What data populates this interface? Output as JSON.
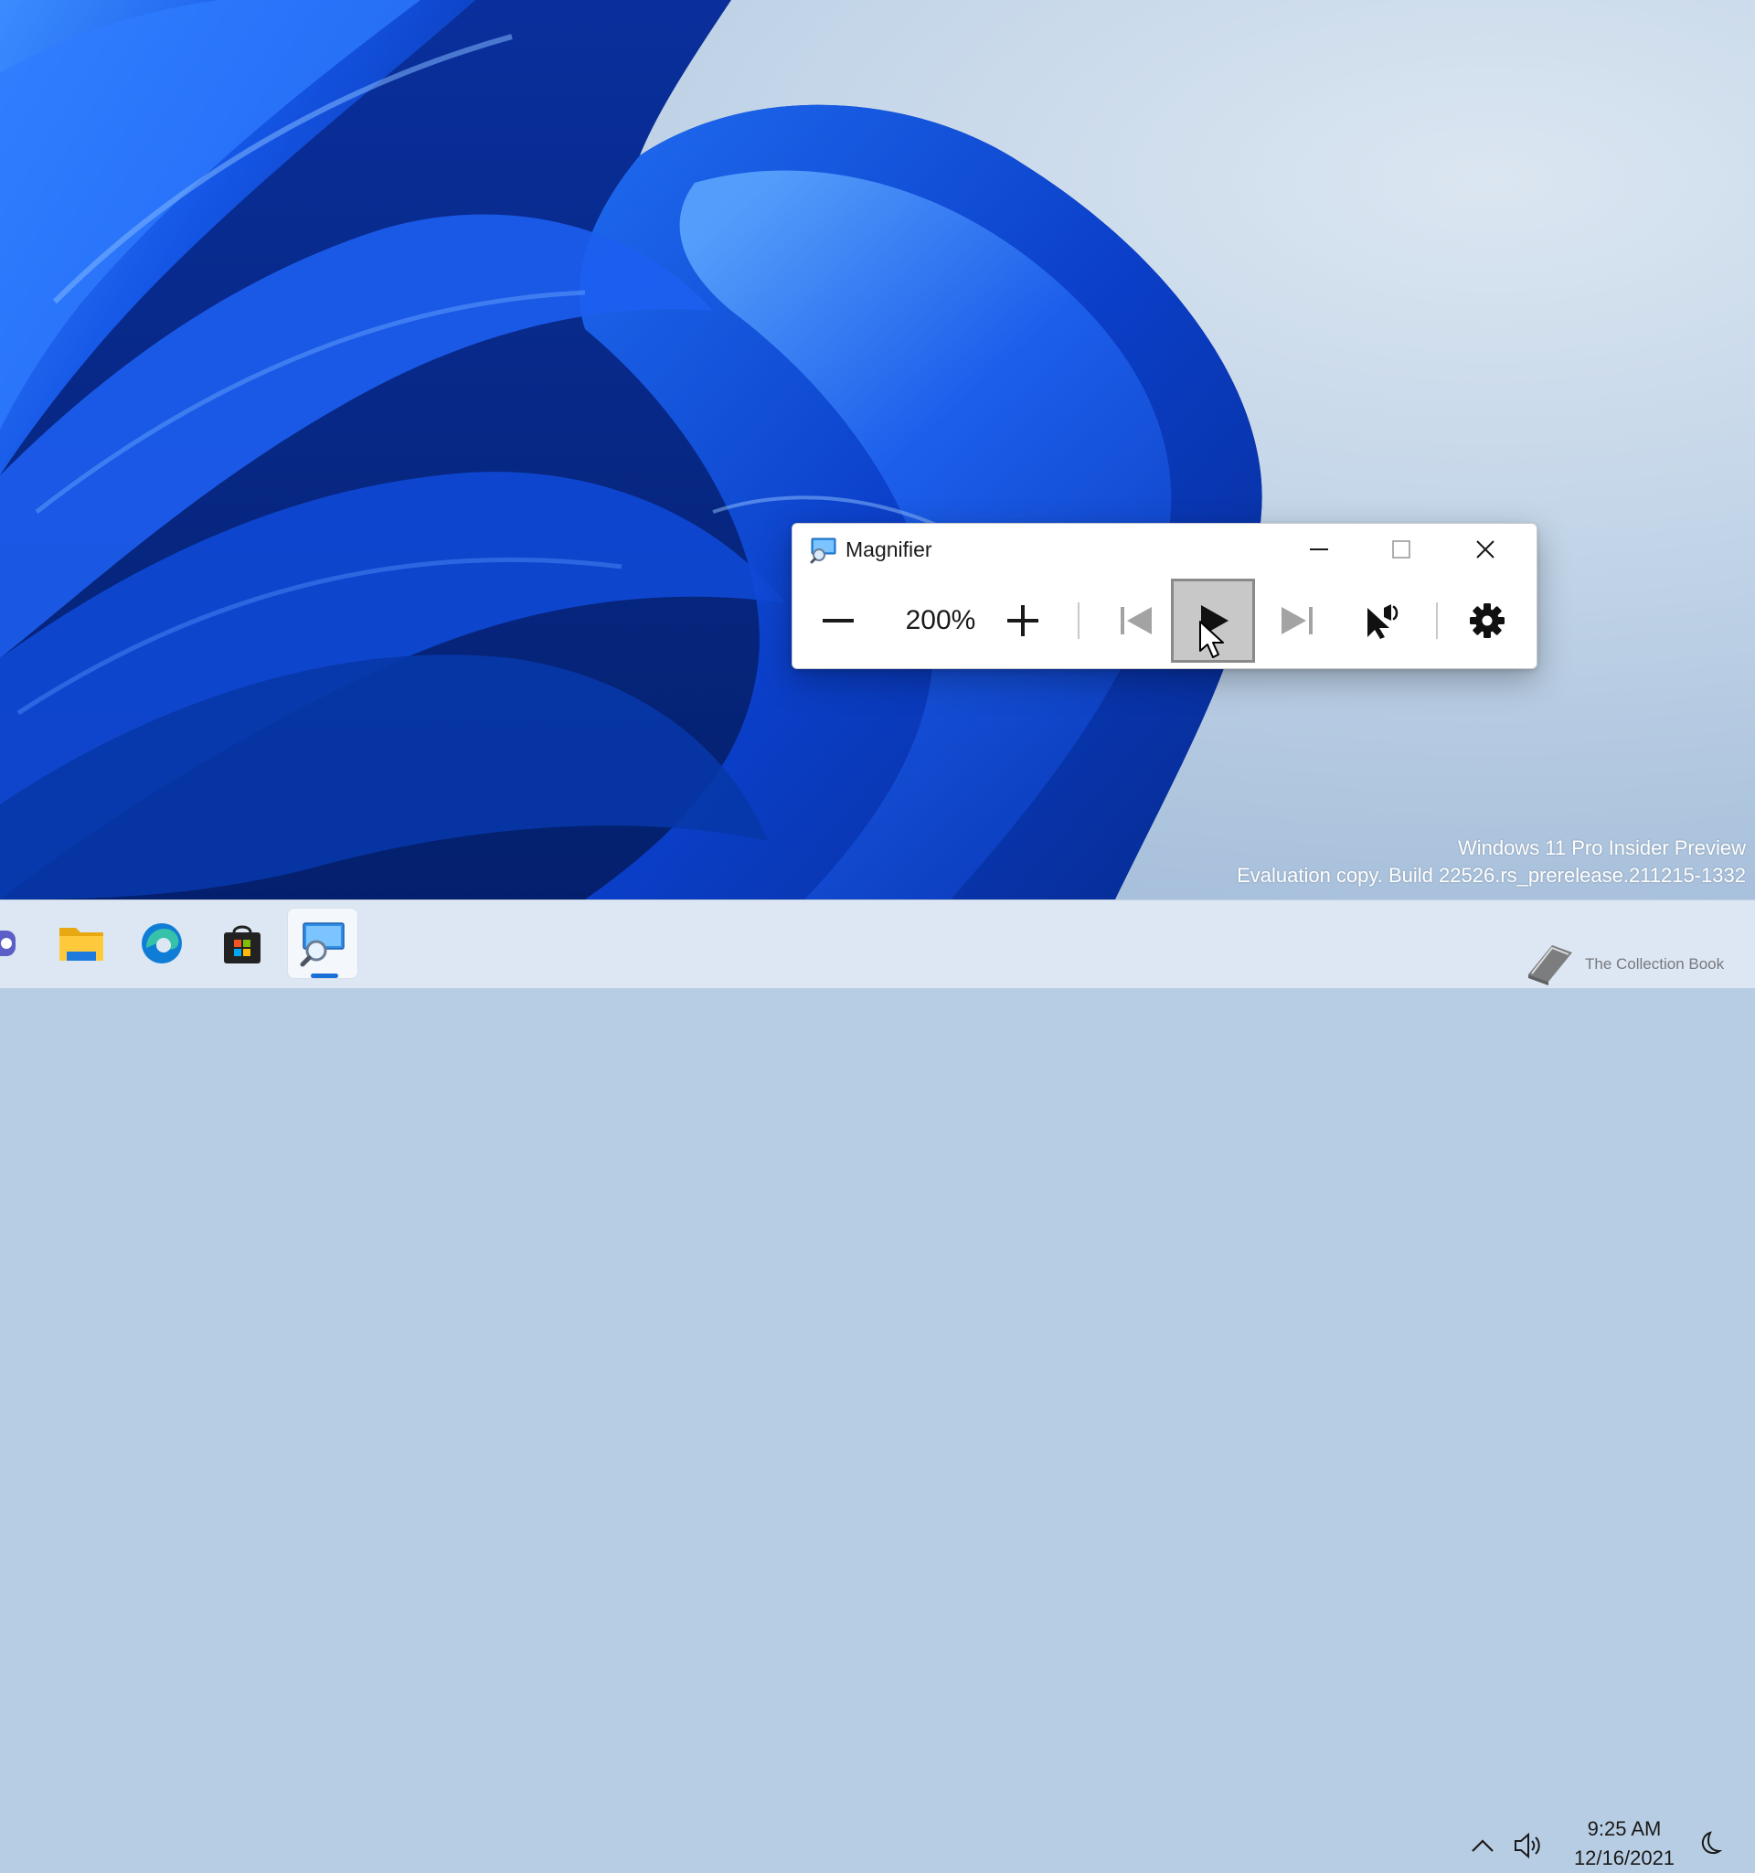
{
  "window": {
    "title": "Magnifier",
    "zoom_level": "200%",
    "buttons": {
      "minimize": "minimize-icon",
      "maximize": "maximize-icon",
      "close": "close-icon",
      "zoom_out": "minus-icon",
      "zoom_in": "plus-icon",
      "previous": "skip-previous-icon",
      "play": "play-icon",
      "next": "skip-next-icon",
      "read_from_here": "read-from-here-icon",
      "settings": "gear-icon"
    }
  },
  "watermark": {
    "line1": "Windows 11 Pro Insider Preview",
    "line2": "Evaluation copy. Build 22526.rs_prerelease.211215-1332"
  },
  "taskbar": {
    "apps": [
      "chat-icon",
      "file-explorer-icon",
      "edge-icon",
      "store-icon",
      "magnifier-icon"
    ],
    "clock_time": "9:25 AM",
    "clock_date": "12/16/2021",
    "overlay_text": "The Collection Book"
  },
  "colors": {
    "accent": "#1a6fd6",
    "wallpaper_blue": "#0a3fd4",
    "taskbar_bg": "#dde7f3"
  }
}
